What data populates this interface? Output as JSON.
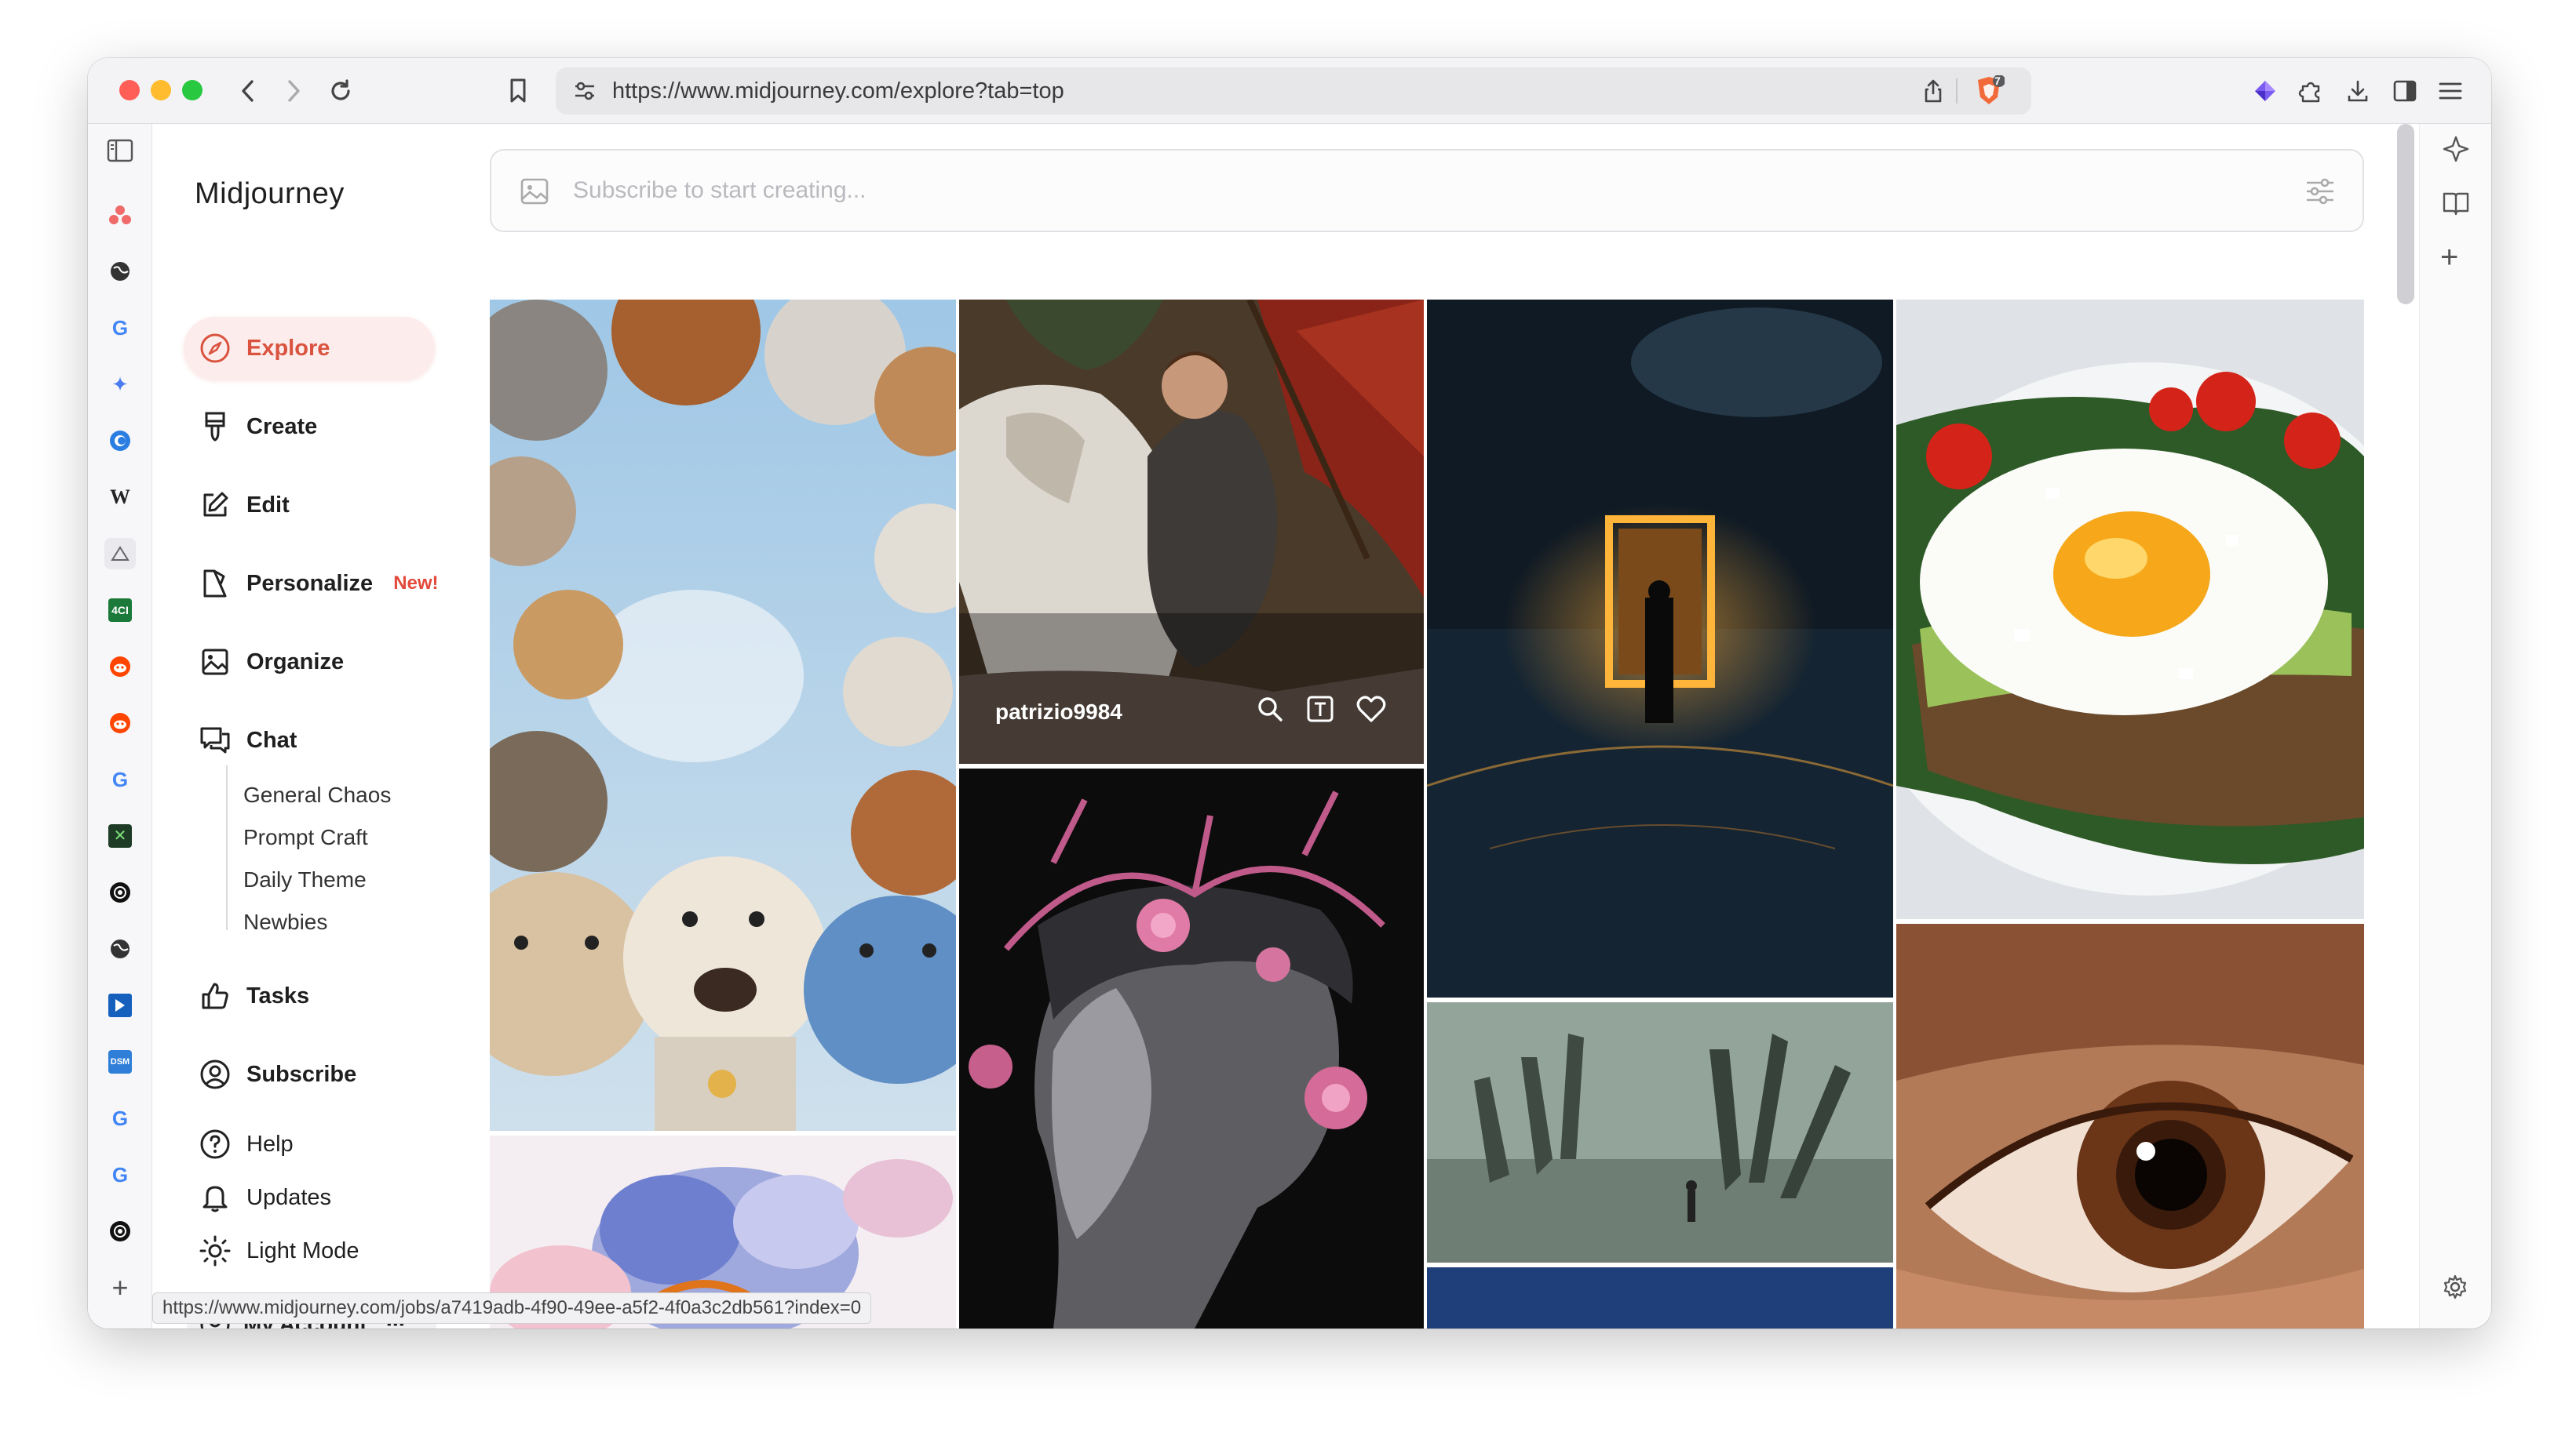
{
  "browser": {
    "url": "https://www.midjourney.com/explore?tab=top",
    "shield_badge": "7",
    "status_url": "https://www.midjourney.com/jobs/a7419adb-4f90-49ee-a5f2-4f0a3c2db561?index=0"
  },
  "rail_icons": [
    "sidebar-toggle-icon",
    "asana-icon",
    "globe-icon",
    "google-icon",
    "gemini-icon",
    "copilot-icon",
    "wikipedia-icon",
    "app-icon",
    "4ci-icon",
    "reddit-icon",
    "reddit-icon",
    "google-icon",
    "app-x-icon",
    "openai-icon",
    "globe-icon",
    "d-app-icon",
    "dsm-icon",
    "google-icon",
    "google-icon",
    "openai-icon",
    "add-icon"
  ],
  "sidebar": {
    "brand": "Midjourney",
    "nav": [
      {
        "label": "Explore",
        "icon": "compass-icon",
        "active": true
      },
      {
        "label": "Create",
        "icon": "brush-icon"
      },
      {
        "label": "Edit",
        "icon": "edit-icon"
      },
      {
        "label": "Personalize",
        "icon": "personalize-icon",
        "badge": "New!"
      },
      {
        "label": "Organize",
        "icon": "image-icon"
      },
      {
        "label": "Chat",
        "icon": "chat-icon"
      }
    ],
    "chat_rooms": [
      "General Chaos",
      "Prompt Craft",
      "Daily Theme",
      "Newbies"
    ],
    "nav2": [
      {
        "label": "Tasks",
        "icon": "thumbs-up-icon"
      },
      {
        "label": "Subscribe",
        "icon": "user-circle-icon"
      }
    ],
    "footer": [
      {
        "label": "Help",
        "icon": "help-icon"
      },
      {
        "label": "Updates",
        "icon": "bell-icon"
      },
      {
        "label": "Light Mode",
        "icon": "sun-icon"
      }
    ],
    "account": {
      "label": "My Account",
      "more": "···"
    }
  },
  "prompt": {
    "placeholder": "Subscribe to start creating..."
  },
  "gallery": {
    "hover_user": "patrizio9984",
    "tiles": [
      {
        "name": "tile-dogs-looking-down"
      },
      {
        "name": "tile-knight-on-horse"
      },
      {
        "name": "tile-glowing-portal-ocean"
      },
      {
        "name": "tile-egg-avocado-toast"
      },
      {
        "name": "tile-pastel-flowers"
      },
      {
        "name": "tile-statue-roses"
      },
      {
        "name": "tile-giant-hands-fog"
      },
      {
        "name": "tile-blue-partial"
      },
      {
        "name": "tile-eye-closeup"
      }
    ]
  },
  "colors": {
    "accent": "#d9533f",
    "active_bg": "#fdecec"
  }
}
